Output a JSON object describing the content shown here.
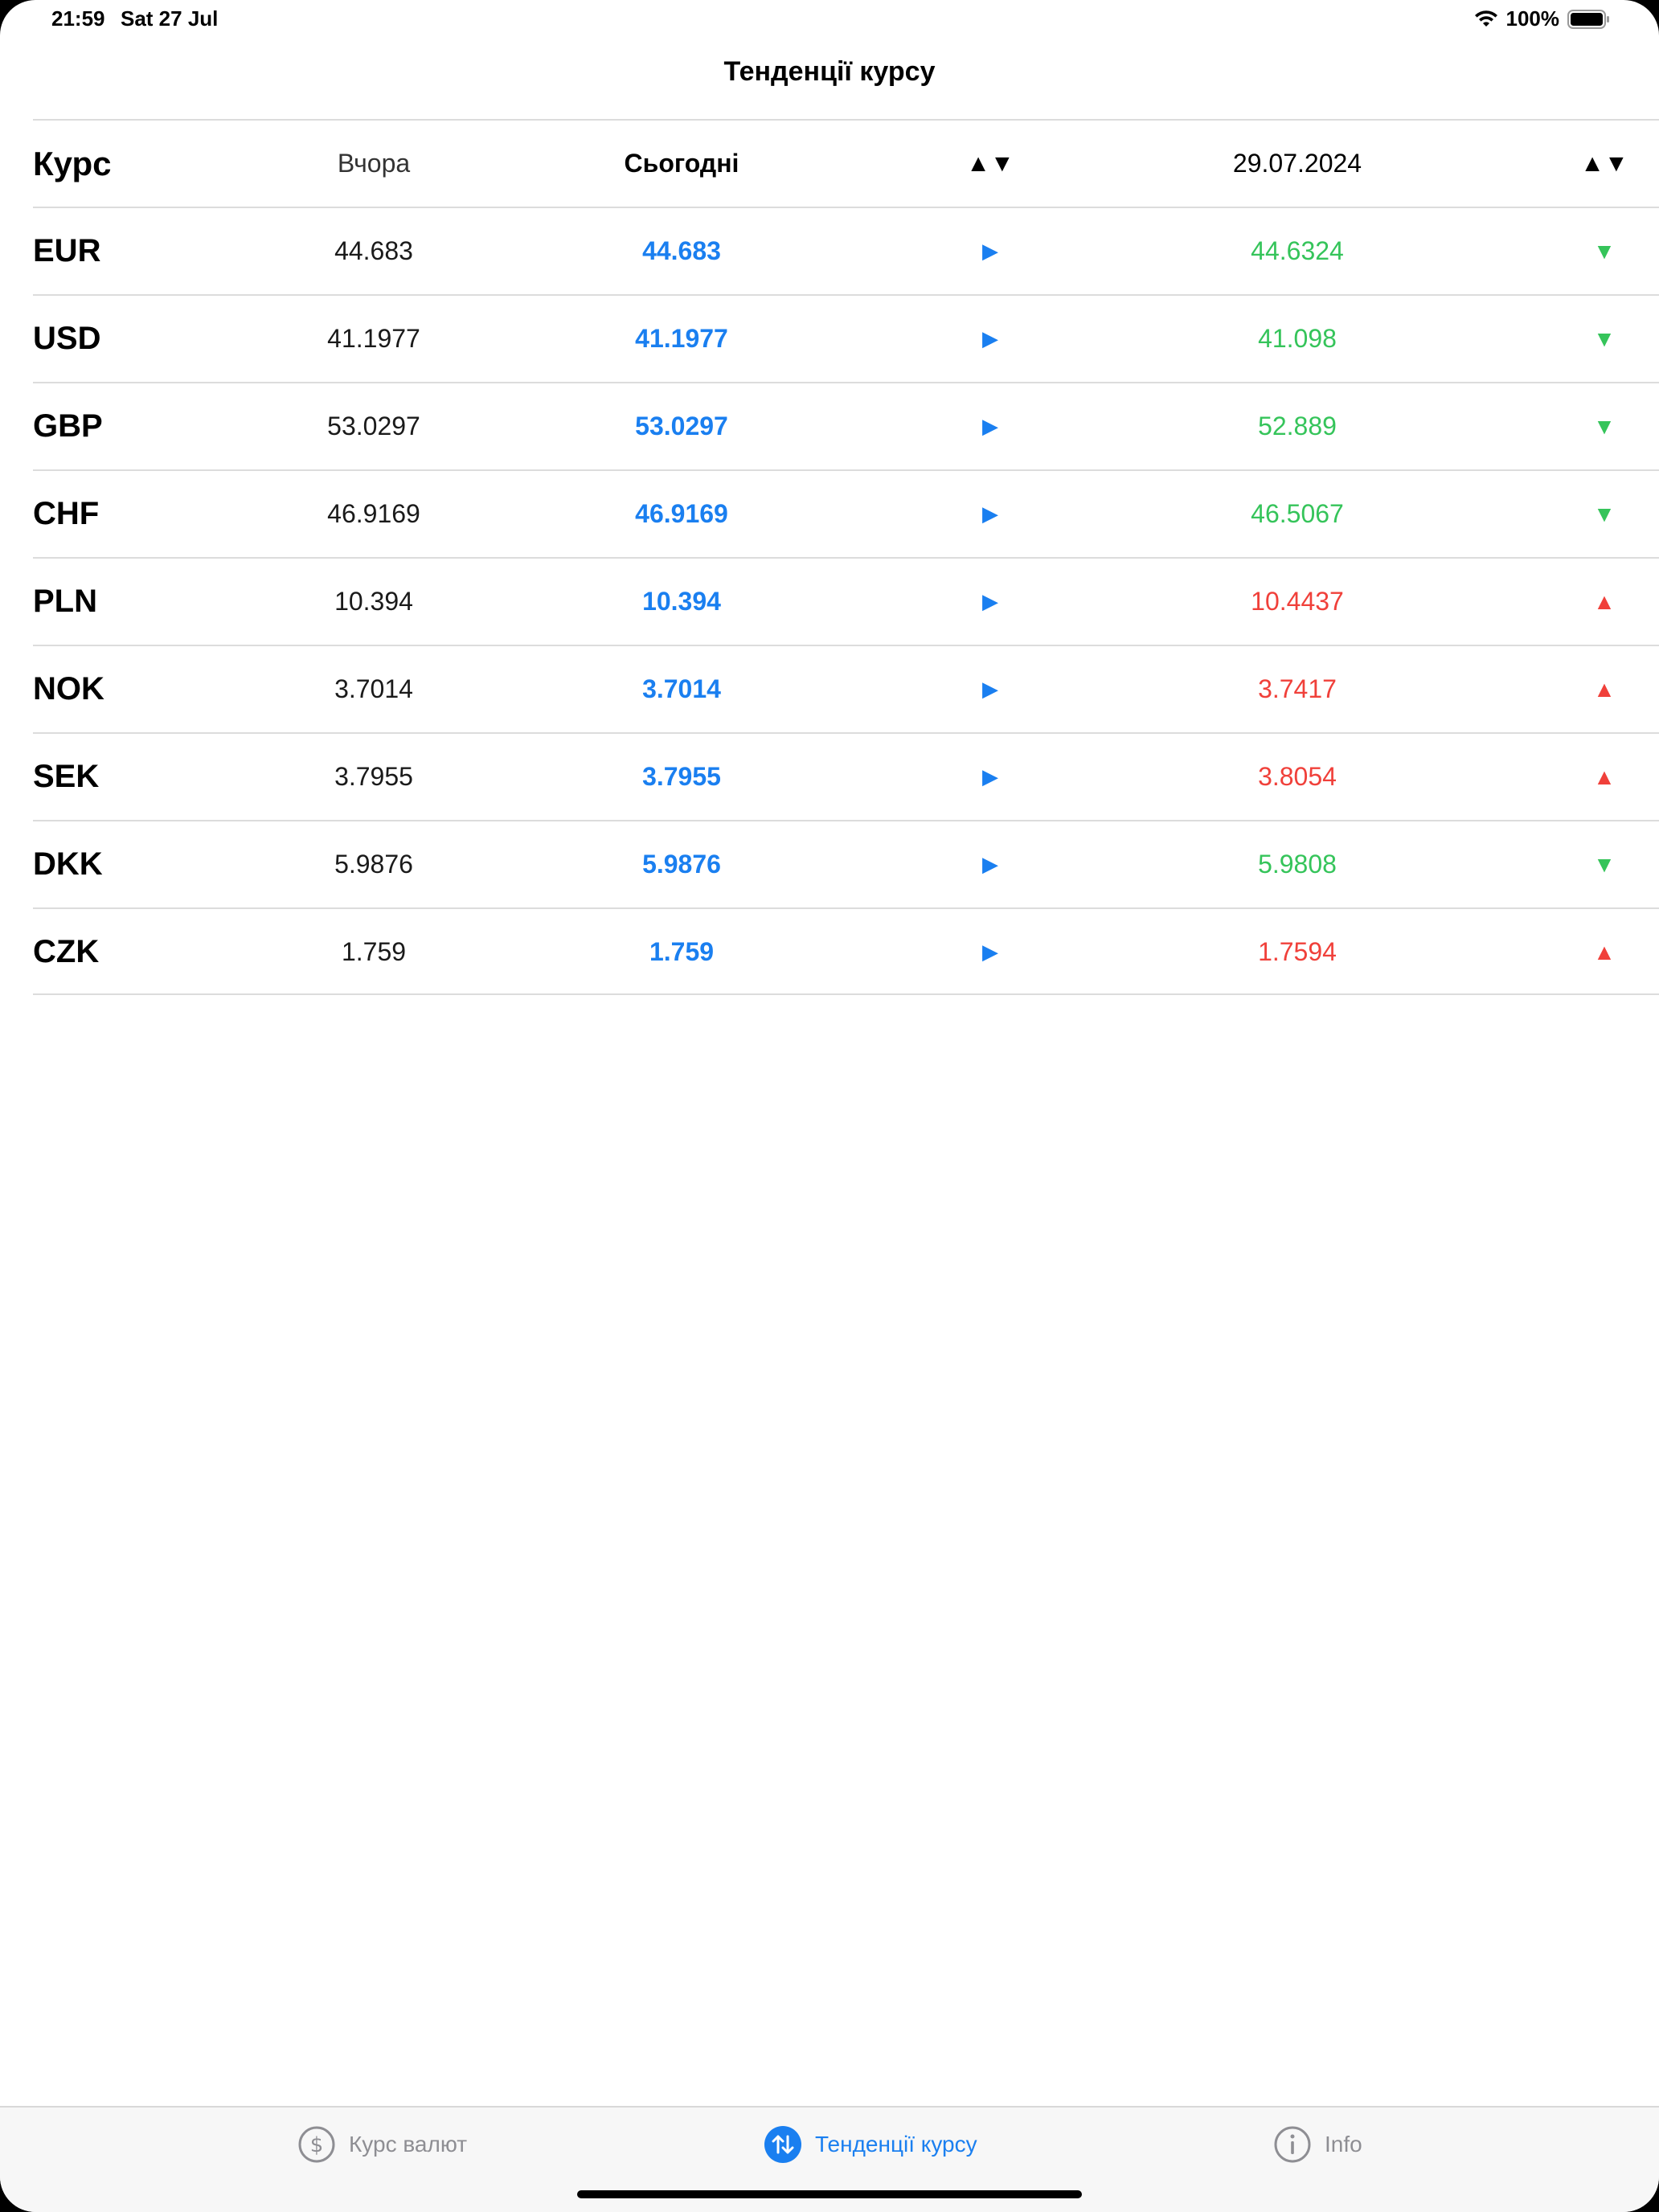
{
  "status_bar": {
    "time": "21:59",
    "date": "Sat 27 Jul",
    "battery": "100%"
  },
  "nav": {
    "title": "Тенденції курсу"
  },
  "table": {
    "header": {
      "code": "Курс",
      "yesterday": "Вчора",
      "today": "Сьогодні",
      "trend1": "▲▼",
      "future_date": "29.07.2024",
      "trend2": "▲▼"
    },
    "rows": [
      {
        "code": "EUR",
        "yesterday": "44.683",
        "today": "44.683",
        "trend1": "▶",
        "future": "44.6324",
        "trend2": "▼",
        "dir": "down"
      },
      {
        "code": "USD",
        "yesterday": "41.1977",
        "today": "41.1977",
        "trend1": "▶",
        "future": "41.098",
        "trend2": "▼",
        "dir": "down"
      },
      {
        "code": "GBP",
        "yesterday": "53.0297",
        "today": "53.0297",
        "trend1": "▶",
        "future": "52.889",
        "trend2": "▼",
        "dir": "down"
      },
      {
        "code": "CHF",
        "yesterday": "46.9169",
        "today": "46.9169",
        "trend1": "▶",
        "future": "46.5067",
        "trend2": "▼",
        "dir": "down"
      },
      {
        "code": "PLN",
        "yesterday": "10.394",
        "today": "10.394",
        "trend1": "▶",
        "future": "10.4437",
        "trend2": "▲",
        "dir": "up"
      },
      {
        "code": "NOK",
        "yesterday": "3.7014",
        "today": "3.7014",
        "trend1": "▶",
        "future": "3.7417",
        "trend2": "▲",
        "dir": "up"
      },
      {
        "code": "SEK",
        "yesterday": "3.7955",
        "today": "3.7955",
        "trend1": "▶",
        "future": "3.8054",
        "trend2": "▲",
        "dir": "up"
      },
      {
        "code": "DKK",
        "yesterday": "5.9876",
        "today": "5.9876",
        "trend1": "▶",
        "future": "5.9808",
        "trend2": "▼",
        "dir": "down"
      },
      {
        "code": "CZK",
        "yesterday": "1.759",
        "today": "1.759",
        "trend1": "▶",
        "future": "1.7594",
        "trend2": "▲",
        "dir": "up"
      }
    ]
  },
  "tab_bar": {
    "tabs": [
      {
        "label": "Курс валют",
        "icon": "dollar-circle-icon",
        "active": false
      },
      {
        "label": "Тенденції курсу",
        "icon": "arrows-up-down-circle-icon",
        "active": true
      },
      {
        "label": "Info",
        "icon": "info-circle-icon",
        "active": false
      }
    ]
  },
  "colors": {
    "accent": "#1a7ff0",
    "up": "#f0403a",
    "down": "#35c45a"
  }
}
